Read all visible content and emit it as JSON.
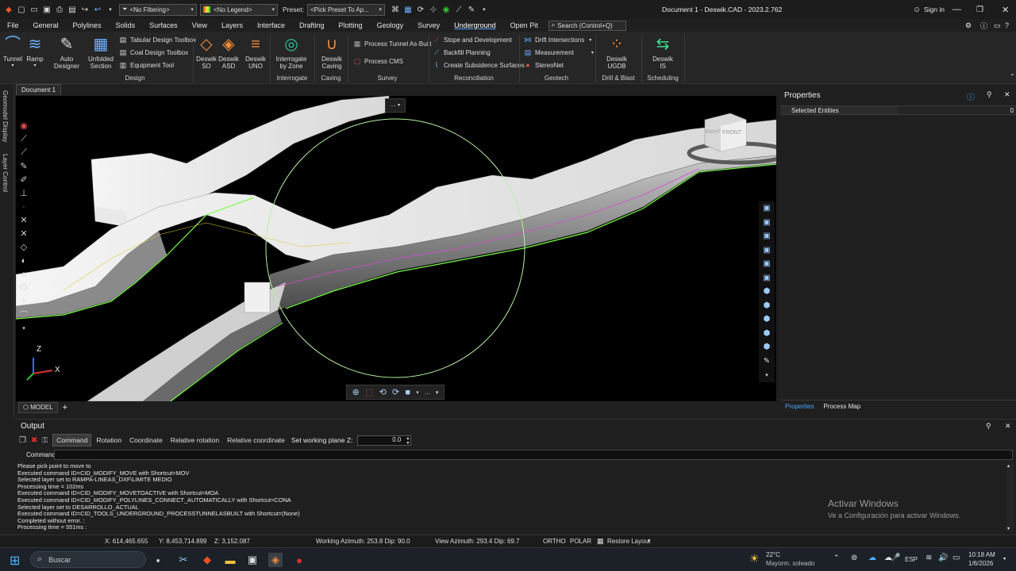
{
  "title": {
    "filter": "<No Filtering>",
    "legend": "<No Legend>",
    "preset_label": "Preset:",
    "preset_value": "<Pick Preset To Ap...",
    "window_title": "Document 1 - Deswik.CAD - 2023.2.762",
    "sign_in": "Sign in"
  },
  "menu": [
    "File",
    "General",
    "Polylines",
    "Solids",
    "Surfaces",
    "View",
    "Layers",
    "Interface",
    "Drafting",
    "Plotting",
    "Geology",
    "Survey",
    "Underground",
    "Open Pit"
  ],
  "menu_active": "Underground",
  "search_placeholder": "Search (Control+Q)",
  "ribbon": {
    "design": {
      "tunnel": "Tunnel",
      "ramp": "Ramp",
      "auto_designer": "Auto Designer",
      "unfolded_l1": "Unfolded",
      "unfolded_l2": "Section",
      "tabular": "Tabular Design Toolbox",
      "coal": "Coal Design Toolbox",
      "equipment": "Equipment Tool",
      "deswik_so_l1": "Deswik",
      "deswik_so_l2": "SO",
      "deswik_asd_l1": "Deswik",
      "deswik_asd_l2": "ASD",
      "deswik_uno_l1": "Deswik",
      "deswik_uno_l2": "UNO",
      "group": "Design"
    },
    "interrogate": {
      "l1": "Interrogate",
      "l2": "by Zone",
      "group": "Interrogate"
    },
    "caving": {
      "l1": "Deswik",
      "l2": "Caving",
      "group": "Caving"
    },
    "survey": {
      "process_tunnel": "Process Tunnel As-Built",
      "process_cms": "Process CMS",
      "group": "Survey"
    },
    "reconciliation": {
      "stope": "Stope and Development",
      "backfill": "Backfill Planning",
      "subsidence": "Create Subsidence Surfaces",
      "group": "Reconciliation"
    },
    "geotech": {
      "drift": "Drift Intersections",
      "measurement": "Measurement",
      "stereonet": "StereoNet",
      "group": "Geotech"
    },
    "drill": {
      "l1": "Deswik",
      "l2": "UGDB",
      "group": "Drill & Blast"
    },
    "scheduling": {
      "l1": "Deswik",
      "l2": "IS",
      "group": "Scheduling"
    }
  },
  "side_tabs": {
    "geomodel": "Geomodel Display",
    "layer": "Layer Control"
  },
  "doc_tab": "Document 1",
  "viewport": {
    "more": "...",
    "axis_z": "Z",
    "axis_x": "X",
    "viewcube_face": "FRONT",
    "viewcube_side": "RIGHT"
  },
  "model_tab": "MODEL",
  "properties": {
    "title": "Properties",
    "selected_label": "Selected Entities",
    "selected_count": "0",
    "tab_properties": "Properties",
    "tab_process_map": "Process Map"
  },
  "output": {
    "title": "Output",
    "tabs": [
      "Command",
      "Rotation",
      "Coordinate",
      "Relative rotation",
      "Relative coordinate"
    ],
    "working_plane_label": "Set working plane Z:",
    "working_plane_value": "0.0",
    "command_label": "Command:",
    "log": [
      "Please pick point to move to",
      "Executed command ID=CID_MODIFY_MOVE with Shortcut=MOV",
      "Selected layer set to RAMPA-LINEAS_DXF\\LIMITE MEDIO",
      "Processing time = 102ms",
      "Executed command ID=CID_MODIFY_MOVETOACTIVE with Shortcut=MOA",
      "Executed command ID=CID_MODIFY_POLYLINES_CONNECT_AUTOMATICALLY with Shortcut=CONA",
      "Selected layer set to DESARROLLO_ACTUAL",
      "Executed command ID=CID_TOOLS_UNDERGROUND_PROCESSTUNNELASBUILT with Shortcut=(None)",
      "Completed without error. :",
      "Processing time = 551ms :"
    ]
  },
  "status": {
    "x": "X: 614,465.655",
    "y": "Y: 8,453,714.899",
    "z": "Z: 3,152.087",
    "working_azimuth": "Working Azimuth: 253.8 Dip: 90.0",
    "view_azimuth": "View Azimuth: 293.4 Dip: 69.7",
    "ortho": "ORTHO",
    "polar": "POLAR",
    "restore_layout": "Restore Layout"
  },
  "activate": {
    "title": "Activar Windows",
    "subtitle": "Ve a Configuración para activar Windows."
  },
  "taskbar": {
    "search": "Buscar",
    "weather_temp": "22°C",
    "weather_desc": "Mayorm. soleado",
    "lang": "ESP",
    "time": "10:18 AM",
    "date": "1/6/2026"
  },
  "colors": {
    "accent": "#4da3ff",
    "tunnel_edge": "#7dff4a",
    "selection_circle": "#b6f0a0"
  }
}
